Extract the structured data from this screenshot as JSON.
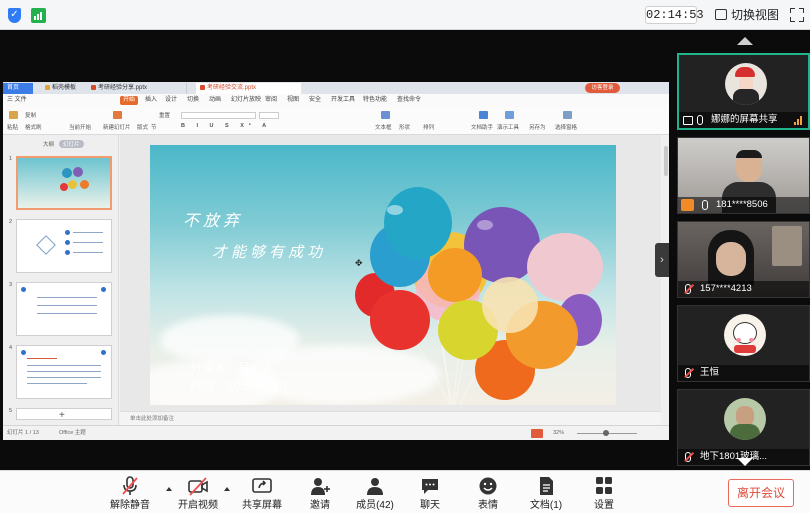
{
  "top_bar": {
    "timer": "02:14:53",
    "switch_view_label": "切换视图"
  },
  "ppt": {
    "tabs": [
      "首页",
      "稻壳模板",
      "考研经验分享.pptx",
      "考研经验交流.pptx"
    ],
    "login_button": "访客登录",
    "menu": [
      "三 文件",
      "开始",
      "插入",
      "设计",
      "切换",
      "动画",
      "幻灯片放映",
      "审阅",
      "视图",
      "安全",
      "开发工具",
      "特色功能",
      "查找命令"
    ],
    "ribbon_labels": [
      "粘贴",
      "复制",
      "格式刷",
      "当前开始",
      "新建幻灯片",
      "版式",
      "节",
      "重置",
      "文本框",
      "形状",
      "排列",
      "文档助手",
      "演示工具",
      "另存为",
      "选择窗格"
    ],
    "thumbnail_tabs": [
      "大纲",
      "幻灯片"
    ],
    "thumbnail_numbers": [
      "1",
      "2",
      "3",
      "4",
      "5"
    ],
    "slide": {
      "slogan_line1": "不放弃",
      "slogan_line2": "才能够有成功",
      "presenter": "分享人：吴广水",
      "date": "时间：2020.6.23"
    },
    "notes_placeholder": "单击此处添加备注",
    "status": {
      "slide_count": "幻灯片 1 / 13",
      "theme": "Office 主题",
      "zoom": "32%"
    }
  },
  "participants": [
    {
      "name": "娜娜的屏幕共享",
      "muted": false
    },
    {
      "name": "181****8506",
      "muted": false
    },
    {
      "name": "157****4213",
      "muted": true
    },
    {
      "name": "王恒",
      "muted": true
    },
    {
      "name": "地下1801玻璃...",
      "muted": true
    }
  ],
  "toolbar": {
    "unmute": "解除静音",
    "start_video": "开启视频",
    "share_screen": "共享屏幕",
    "invite": "邀请",
    "members": "成员(42)",
    "chat": "聊天",
    "reactions": "表情",
    "documents": "文档(1)",
    "settings": "设置",
    "leave": "离开会议"
  },
  "colors": {
    "accent": "#20b38c",
    "leave_red": "#e04a3a",
    "ppt_orange": "#e56a2c",
    "mute_red": "#f04d4d"
  }
}
